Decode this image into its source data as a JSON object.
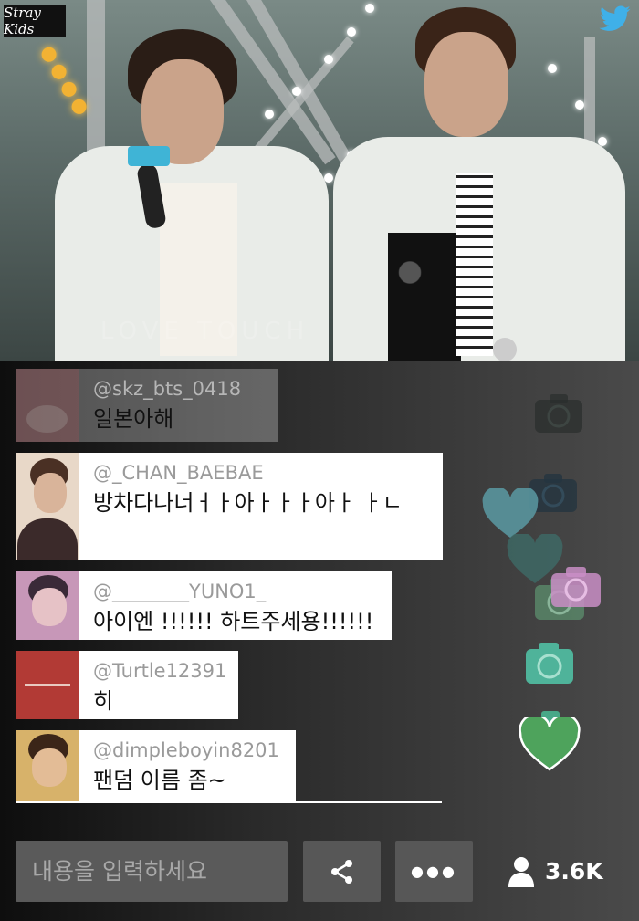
{
  "video": {
    "logo_text": "Stray Kids",
    "twitter_icon": "twitter-bird-icon",
    "watermark": "LOVE  TOUCH"
  },
  "comments": [
    {
      "username": "@skz_bts_0418",
      "text": "일본아해",
      "avatar_color": "#b9868a"
    },
    {
      "username": "@_CHAN_BAEBAE",
      "text": "방차다나너ㅓㅏ아ㅏㅏㅏ아ㅏ ㅏㄴ",
      "avatar_color": "#c9a48b"
    },
    {
      "username": "@________YUNO1_",
      "text": "아이엔 !!!!!! 하트주세용!!!!!!",
      "avatar_color": "#b07a9a"
    },
    {
      "username": "@Turtle12391",
      "text": "히",
      "avatar_color": "#b23a35"
    },
    {
      "username": "@dimpleboyin8201",
      "text": "팬덤 이름 좀~",
      "avatar_color": "#c6a25a"
    }
  ],
  "input": {
    "placeholder": "내용을 입력하세요"
  },
  "buttons": {
    "share_icon": "share-icon",
    "more_label": "●●●"
  },
  "viewers": {
    "count": "3.6K",
    "icon": "user-icon"
  },
  "colors": {
    "heart_teal": "#5a9aa3",
    "camera_green": "#4fb39a",
    "heart_green": "#4ea35c",
    "camera_pink": "#c98ec6"
  }
}
